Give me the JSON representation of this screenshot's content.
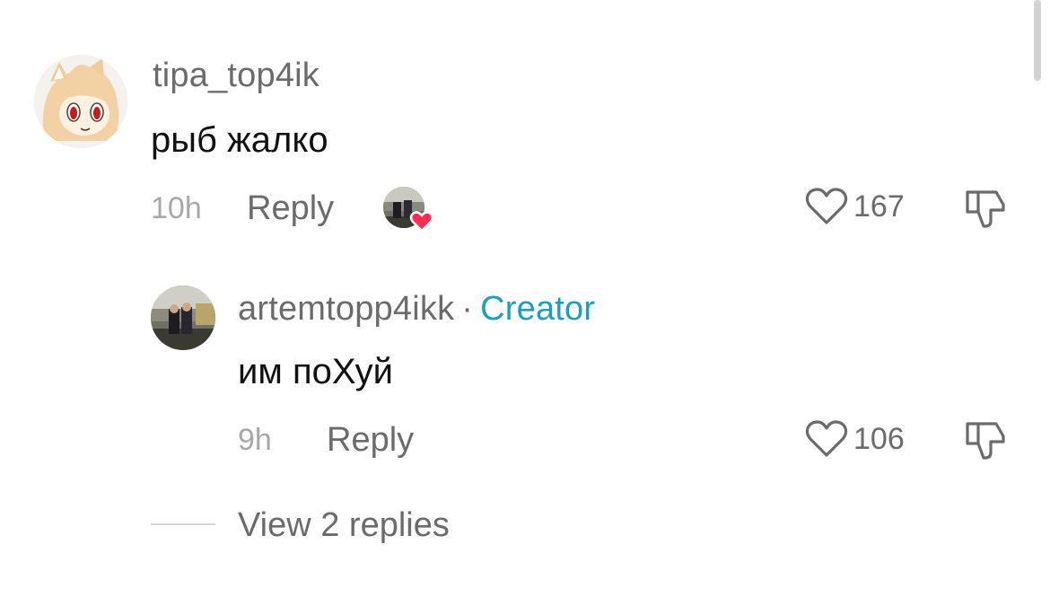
{
  "comments": [
    {
      "username": "tipa_top4ik",
      "text": "рыб жалко",
      "time": "10h",
      "reply_label": "Reply",
      "likes": "167",
      "creator_liked": true
    }
  ],
  "replies": [
    {
      "username": "artemtopp4ikk",
      "separator": "·",
      "badge": "Creator",
      "text": "им поХуй",
      "time": "9h",
      "reply_label": "Reply",
      "likes": "106"
    }
  ],
  "view_replies_label": "View 2 replies",
  "colors": {
    "creator_badge": "#1a9fbd",
    "heart_badge": "#fe2c55",
    "muted_text": "#6b6b6b",
    "time_text": "#a8a8a8"
  }
}
